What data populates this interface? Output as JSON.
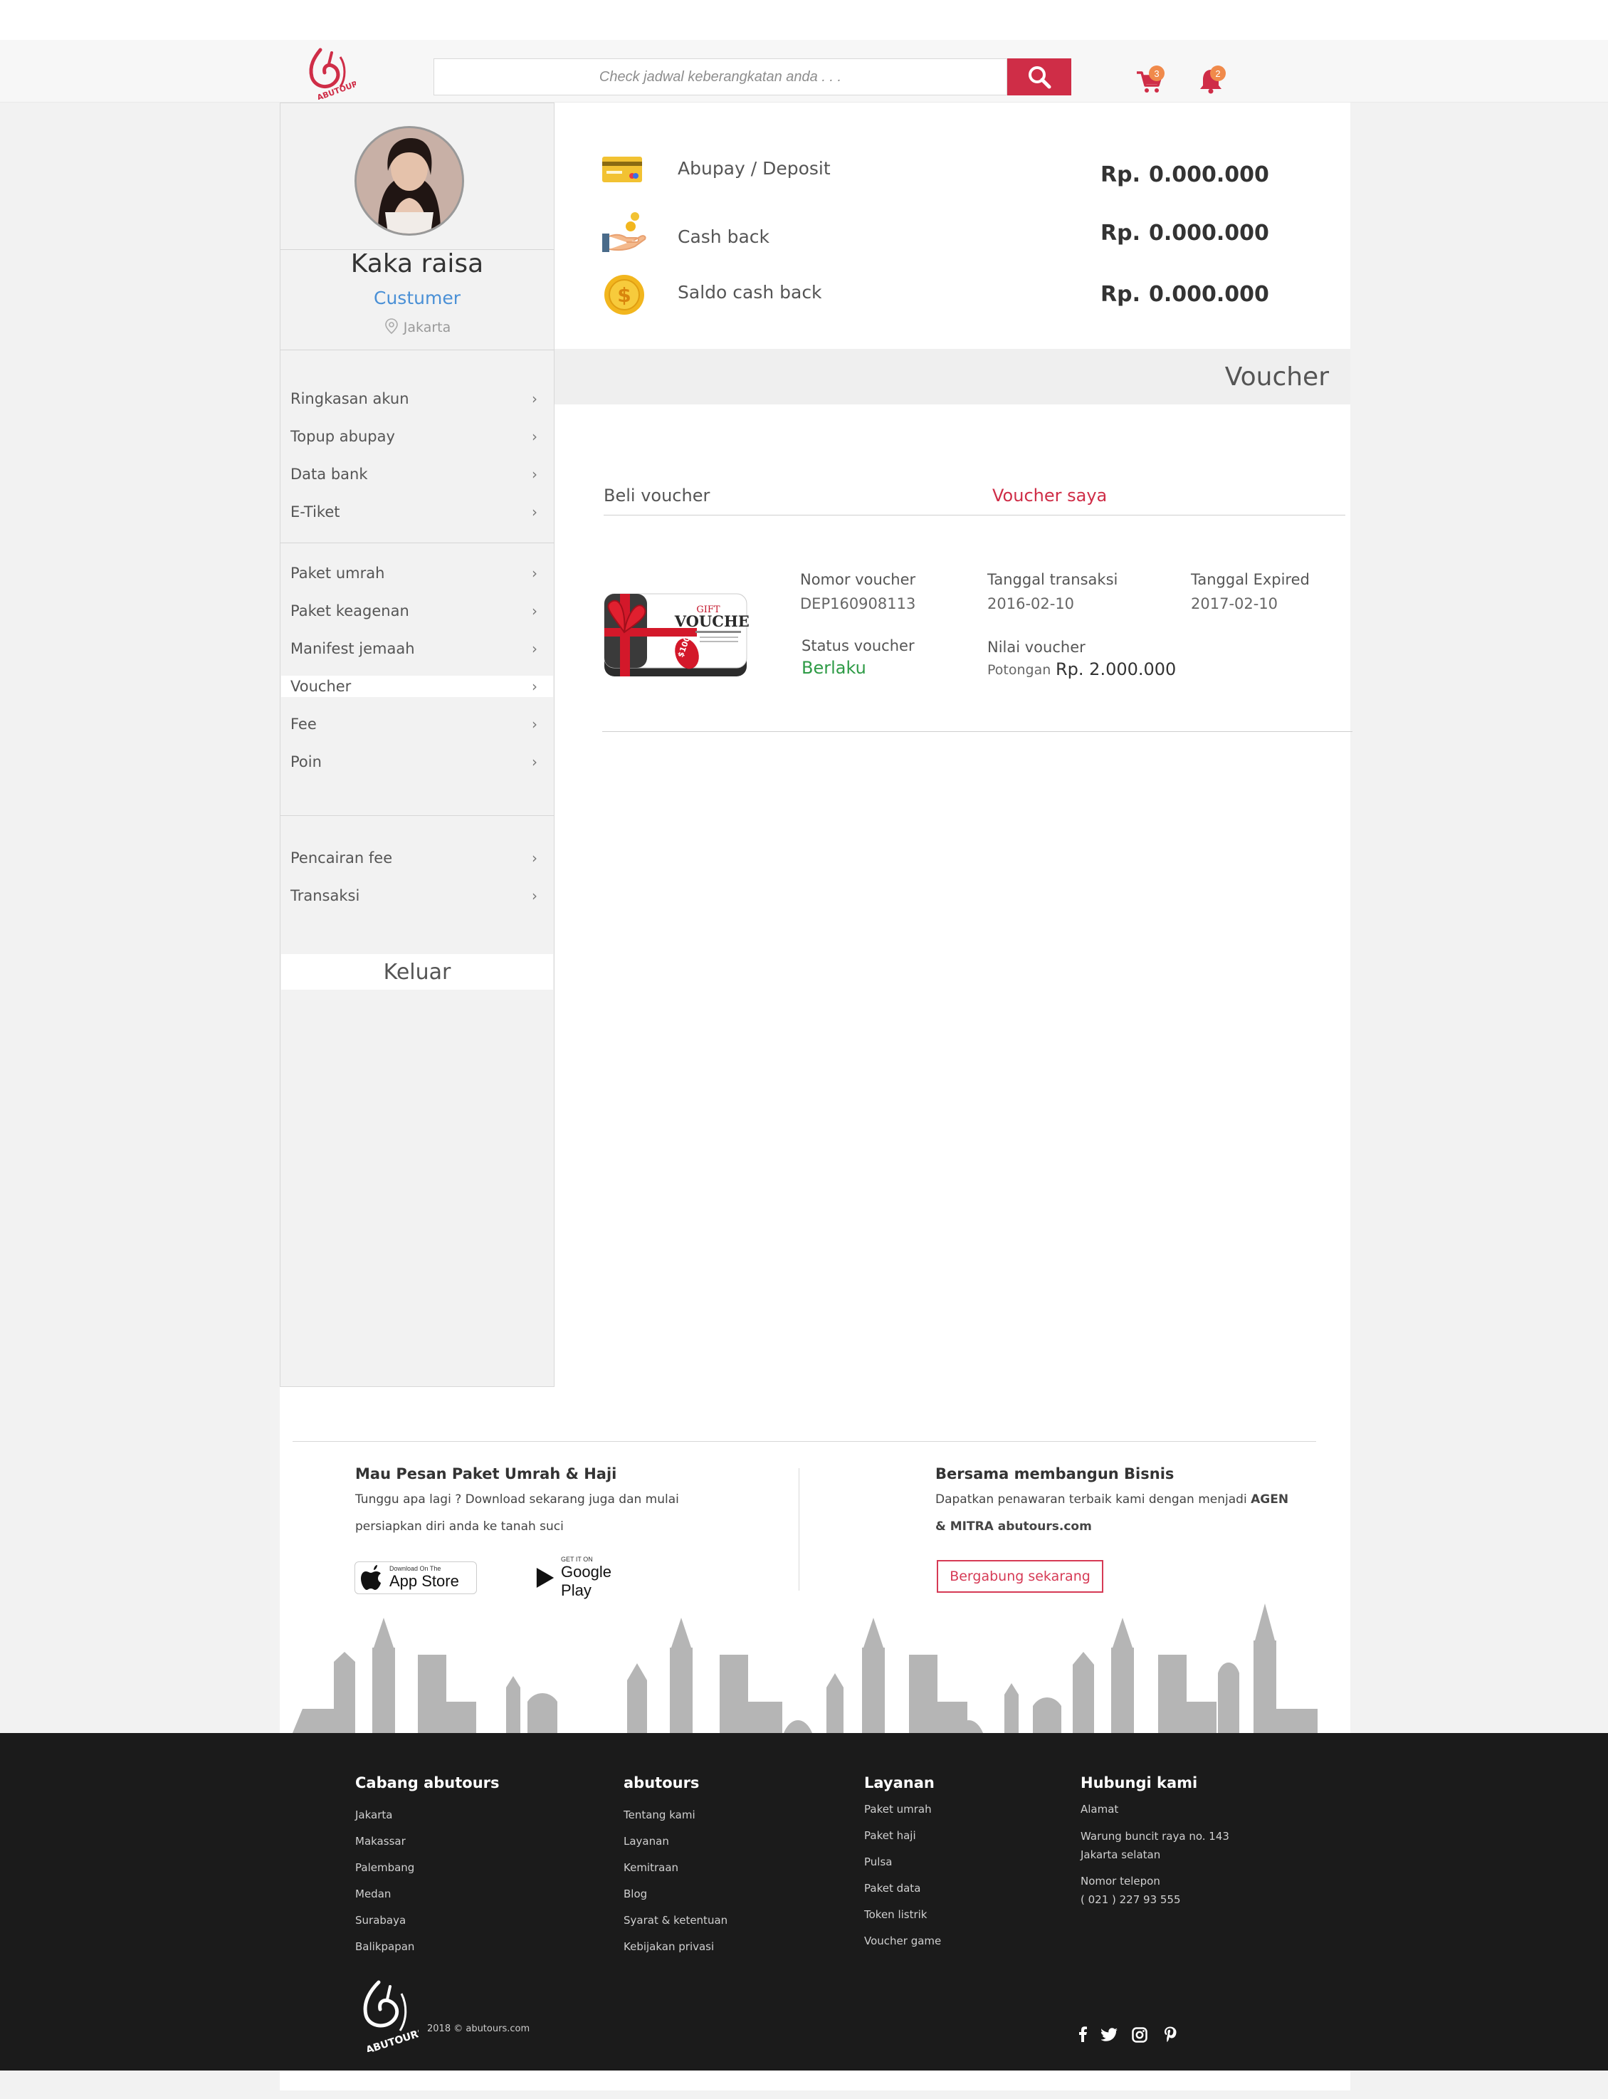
{
  "header": {
    "search_placeholder": "Check jadwal keberangkatan anda . . .",
    "cart_count": "3",
    "notif_count": "2"
  },
  "profile": {
    "name": "Kaka raisa",
    "role": "Custumer",
    "location": "Jakarta"
  },
  "menu": {
    "group1": [
      "Ringkasan akun",
      "Topup abupay",
      "Data bank",
      "E-Tiket"
    ],
    "group2": [
      "Paket umrah",
      "Paket keagenan",
      "Manifest jemaah",
      "Voucher",
      "Fee",
      "Poin"
    ],
    "group3": [
      "Pencairan fee",
      "Transaksi"
    ],
    "logout": "Keluar"
  },
  "balances": [
    {
      "label": "Abupay / Deposit",
      "currency": "Rp.",
      "value": "0.000.000",
      "icon": "card-icon"
    },
    {
      "label": "Cash back",
      "currency": "Rp.",
      "value": "0.000.000",
      "icon": "hand-coin-icon"
    },
    {
      "label": "Saldo cash back",
      "currency": "Rp.",
      "value": "0.000.000",
      "icon": "coin-icon"
    }
  ],
  "voucher_section": {
    "title": "Voucher",
    "tab_buy": "Beli voucher",
    "tab_mine": "Voucher saya",
    "item": {
      "image_text_gift": "GIFT",
      "image_text_voucher": "VOUCHER",
      "image_text_amount": "$100",
      "nomor_label": "Nomor voucher",
      "nomor_value": "DEP160908113",
      "transaksi_label": "Tanggal transaksi",
      "transaksi_value": "2016-02-10",
      "expired_label": "Tanggal Expired",
      "expired_value": "2017-02-10",
      "status_label": "Status voucher",
      "status_value": "Berlaku",
      "nilai_label": "Nilai voucher",
      "nilai_prefix": "Potongan",
      "nilai_value": "Rp. 2.000.000"
    }
  },
  "footer": {
    "left_title": "Mau Pesan Paket Umrah & Haji",
    "left_line1": "Tunggu apa lagi ? Download sekarang juga dan mulai",
    "left_line2": "persiapkan diri anda ke tanah suci",
    "appstore_small": "Download On The",
    "appstore_big": "App Store",
    "gplay_small": "GET IT ON",
    "gplay_big": "Google Play",
    "right_title": "Bersama membangun Bisnis",
    "right_line1_a": "Dapatkan penawaran terbaik kami dengan menjadi ",
    "right_line1_b": "AGEN",
    "right_line2": "& MITRA abutours.com",
    "join_button": "Bergabung sekarang",
    "columns": [
      {
        "title": "Cabang abutours",
        "items": [
          "Jakarta",
          "Makassar",
          "Palembang",
          "Medan",
          "Surabaya",
          "Balikpapan"
        ]
      },
      {
        "title": "abutours",
        "items": [
          "Tentang kami",
          "Layanan",
          "Kemitraan",
          "Blog",
          "Syarat & ketentuan",
          "Kebijakan privasi"
        ]
      },
      {
        "title": "Layanan",
        "items": [
          "Paket umrah",
          "Paket haji",
          "Pulsa",
          "Paket data",
          "Token listrik",
          "Voucher game"
        ]
      }
    ],
    "contact": {
      "title": "Hubungi kami",
      "address_label": "Alamat",
      "address_line1": "Warung buncit raya no. 143",
      "address_line2": "Jakarta selatan",
      "phone_label": "Nomor telepon",
      "phone_value": "( 021 )  227 93 555"
    },
    "copyright": "2018 ©  abutours.com",
    "logo_text": "ABUTOURS"
  },
  "colors": {
    "brand_red": "#cf2d47",
    "status_green": "#2e9b46",
    "role_blue": "#4a90d6",
    "footer_dark": "#1b1b1b"
  }
}
